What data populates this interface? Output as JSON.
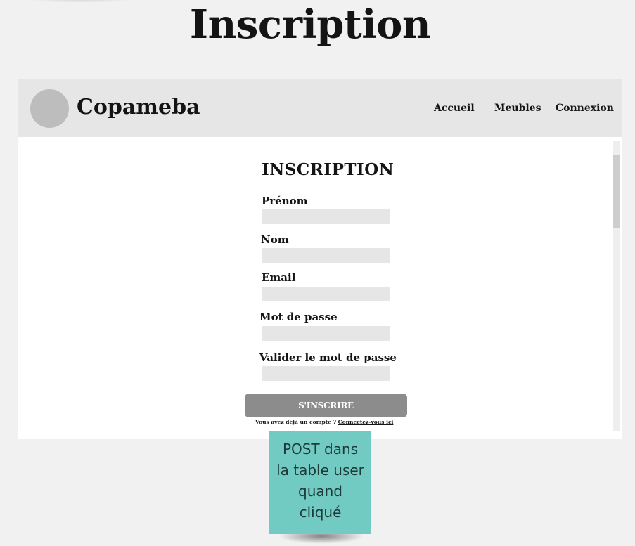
{
  "page": {
    "title": "Inscription"
  },
  "navbar": {
    "brand": "Copameba",
    "links": [
      "Accueil",
      "Meubles",
      "Connexion"
    ]
  },
  "form": {
    "title": "INSCRIPTION",
    "fields": [
      {
        "label": "Prénom",
        "value": ""
      },
      {
        "label": "Nom",
        "value": ""
      },
      {
        "label": "Email",
        "value": ""
      },
      {
        "label": "Mot de passe",
        "value": ""
      },
      {
        "label": "Valider le mot de passe",
        "value": ""
      }
    ],
    "submit_label": "S'INSCRIRE",
    "login_prompt": "Vous avez déjà un compte ?",
    "login_link": "Connectez-vous ici"
  },
  "annotation": {
    "text": "POST dans la table user quand cliqué",
    "color": "#72cbc3"
  },
  "colors": {
    "background": "#f1f1f1",
    "navbar": "#e6e6e6",
    "button": "#8c8c8c",
    "input": "#e6e6e6"
  }
}
